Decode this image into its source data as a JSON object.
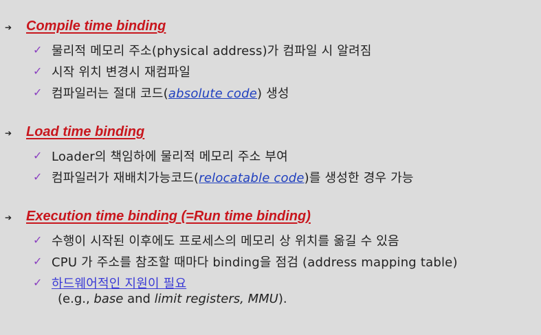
{
  "sections": [
    {
      "title": "Compile time binding",
      "items": [
        {
          "pre": "물리적 메모리 주소(physical address)가 컴파일 시 알려짐"
        },
        {
          "pre": "시작 위치 변경시 재컴파일"
        },
        {
          "pre": "컴파일러는 절대 코드(",
          "em": "absolute code",
          "post": ") 생성"
        }
      ]
    },
    {
      "title": "Load time binding",
      "items": [
        {
          "pre": "Loader의 책임하에 물리적 메모리 주소 부여"
        },
        {
          "pre": "컴파일러가 재배치가능코드(",
          "em": "relocatable code",
          "post": ")를 생성한 경우 가능"
        }
      ]
    },
    {
      "title": "Execution time binding (=Run time binding)",
      "items": [
        {
          "pre": "수행이 시작된 이후에도 프로세스의 메모리 상 위치를 옮길 수 있음"
        },
        {
          "pre": "CPU 가 주소를 참조할 때마다 binding을 점검 (address mapping table)"
        },
        {
          "link": "하드웨어적인 지원이 필요"
        }
      ],
      "sub": {
        "pre": "(e.g., ",
        "i1": "base",
        "mid1": " and ",
        "i2": "limit registers, MMU",
        "post": ")."
      }
    }
  ],
  "icons": {
    "bullet": "arrow-bullet-icon",
    "check": "checkmark-icon"
  },
  "colors": {
    "title": "#c8161d",
    "check": "#8a3fc0",
    "emphasis": "#1f3fbf",
    "background": "#dcdcdc"
  }
}
